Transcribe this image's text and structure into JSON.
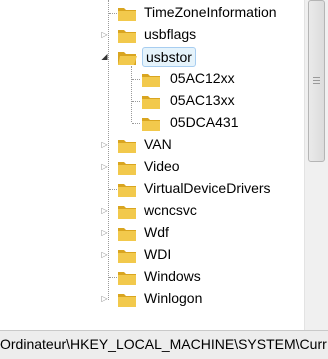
{
  "tree": {
    "items": [
      {
        "label": "TimeZoneInformation",
        "expander": "none",
        "selected": false
      },
      {
        "label": "usbflags",
        "expander": "collapsed",
        "selected": false
      },
      {
        "label": "usbstor",
        "expander": "expanded",
        "selected": true
      },
      {
        "label": "05AC12xx",
        "expander": "none",
        "selected": false
      },
      {
        "label": "05AC13xx",
        "expander": "none",
        "selected": false
      },
      {
        "label": "05DCA431",
        "expander": "none",
        "selected": false
      },
      {
        "label": "VAN",
        "expander": "collapsed",
        "selected": false
      },
      {
        "label": "Video",
        "expander": "collapsed",
        "selected": false
      },
      {
        "label": "VirtualDeviceDrivers",
        "expander": "none",
        "selected": false
      },
      {
        "label": "wcncsvc",
        "expander": "collapsed",
        "selected": false
      },
      {
        "label": "Wdf",
        "expander": "collapsed",
        "selected": false
      },
      {
        "label": "WDI",
        "expander": "collapsed",
        "selected": false
      },
      {
        "label": "Windows",
        "expander": "none",
        "selected": false
      },
      {
        "label": "Winlogon",
        "expander": "collapsed",
        "selected": false
      }
    ],
    "icon": "folder-icon"
  },
  "statusbar": {
    "path": "Ordinateur\\HKEY_LOCAL_MACHINE\\SYSTEM\\Curr"
  },
  "colors": {
    "folder": "#f2c94c",
    "folder_dark": "#d9a520",
    "selection_border": "#a7cdf0",
    "selection_fill": "#e5f3fb"
  }
}
